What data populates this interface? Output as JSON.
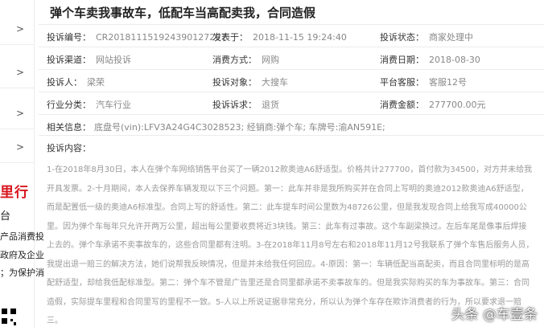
{
  "sidebar": {
    "chevron": ">",
    "brand": "里行",
    "texts": [
      "台",
      "产品消费投",
      "政府及企业",
      "；为保护消"
    ]
  },
  "complaint": {
    "title": "弹个车卖我事故车，低配车当高配卖我，合同造假",
    "fields": [
      {
        "label": "投诉编号：",
        "value": "CR20181115192439012729​7"
      },
      {
        "label": "发表于：",
        "value": "2018-11-15 19:24:40"
      },
      {
        "label": "投诉状态：",
        "value": "商家处理中"
      },
      {
        "label": "投诉渠道：",
        "value": "网站投诉"
      },
      {
        "label": "消费方式：",
        "value": "网购"
      },
      {
        "label": "消费日期：",
        "value": "2018-08-30"
      },
      {
        "label": "投诉人：",
        "value": "梁荣"
      },
      {
        "label": "投诉对象：",
        "value": "大搜车"
      },
      {
        "label": "平台客服：",
        "value": "客服12号"
      },
      {
        "label": "行业分类：",
        "value": "汽车行业"
      },
      {
        "label": "投诉诉求：",
        "value": "退货"
      },
      {
        "label": "消费金额：",
        "value": "277700.00元"
      }
    ],
    "related_label": "相关信息：",
    "related_value": "底盘号(vin):LFV3A24G4C3028523; 经销商:弹个车; 车牌号:渝AN591E;",
    "content_label": "投诉内容：",
    "content": "1-在2018年8月30日，本人在弹个车网络销售平台买了一辆2012款奥迪A6舒适型。价格共计277700，首付款为34500，对方并未给我开具发票。2-十月期间，本人去保养车辆发现以下三个问题。第一：此车并非是我所购买并在合同上写明的奥迪2012款奥迪A6舒适型，而是配置低一级的奥迪A6标准型。合同上写的舒适性。第二：此车提车时间公里数为48726公里，但是我发现合同上给我写成40000公里。因为弹个车每年只允许开两万公里，超出每公里要收费将近3块钱。第三：此车有过事故。这个车副梁换过。左后车尾是像事后焊接上去的。弹个车承诺不卖事故车的，这些合同里都有注明。3-在2018年11月8号左右和2018年11月12号我联系了弹个车售后服务人员，我提出退一赔三的解决方法，她们说帮我反映情况，但是并未给我任何回应。4-原因：第一：车辆低配当高配卖，而且合同里标明的是高配舒适型，却给我低配标准型。第二：弹个车不管是广告里还是合同里都承诺不卖事故车的。但是我实际购买的车为事故车。第三：合同造假，实际提车里程和合同里写的里程不一致。5-人以上所说证据非常充分，所以认为弹个车存在欺诈消费者的行为，所以要求退一赔三。"
  },
  "watermark": "头条 @车壹条"
}
